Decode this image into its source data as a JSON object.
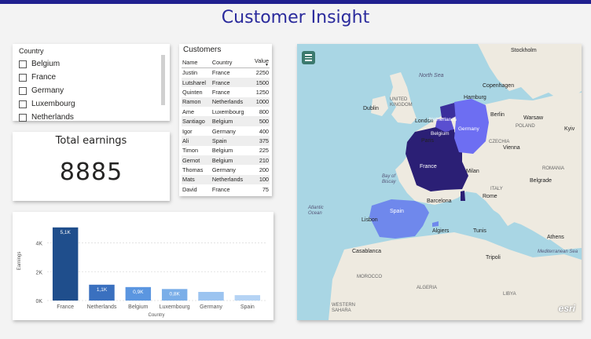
{
  "report": {
    "title": "Customer Insight"
  },
  "slicer": {
    "title": "Country",
    "items": [
      "Belgium",
      "France",
      "Germany",
      "Luxembourg",
      "Netherlands"
    ]
  },
  "kpi": {
    "label": "Total earnings",
    "value": "8885"
  },
  "customers": {
    "title": "Customers",
    "columns": [
      "Name",
      "Country",
      "Value"
    ],
    "rows": [
      [
        "Justin",
        "France",
        "2250"
      ],
      [
        "Lutsharel",
        "France",
        "1500"
      ],
      [
        "Quinten",
        "France",
        "1250"
      ],
      [
        "Ramon",
        "Netherlands",
        "1000"
      ],
      [
        "Ame",
        "Luxembourg",
        "800"
      ],
      [
        "Santiago",
        "Belgium",
        "500"
      ],
      [
        "Igor",
        "Germany",
        "400"
      ],
      [
        "Ali",
        "Spain",
        "375"
      ],
      [
        "Timon",
        "Belgium",
        "225"
      ],
      [
        "Gernot",
        "Belgium",
        "210"
      ],
      [
        "Thomas",
        "Germany",
        "200"
      ],
      [
        "Mats",
        "Netherlands",
        "100"
      ],
      [
        "David",
        "France",
        "75"
      ]
    ]
  },
  "chart_data": {
    "type": "bar",
    "categories": [
      "France",
      "Netherlands",
      "Belgium",
      "Luxembourg",
      "Germany",
      "Spain"
    ],
    "values": [
      5075,
      1100,
      935,
      800,
      600,
      375
    ],
    "data_labels": [
      "5,1K",
      "1,1K",
      "0,9K",
      "0,8K",
      "",
      ""
    ],
    "xlabel": "Country",
    "ylabel": "Earnings",
    "ylim": [
      0,
      5500
    ],
    "yticks": [
      0,
      2000,
      4000
    ],
    "ytick_labels": [
      "0K",
      "2K",
      "4K"
    ],
    "colors": [
      "#1f4e8c",
      "#3a70bf",
      "#5b96e0",
      "#7aaee8",
      "#9cc4f0",
      "#b5d3f4"
    ],
    "grid": true
  },
  "map": {
    "labels": {
      "stockholm": "Stockholm",
      "northsea": "North Sea",
      "copenhagen": "Copenhagen",
      "uk": "UNITED\nKINGDOM",
      "dublin": "Dublin",
      "hamburg": "Hamburg",
      "london": "London",
      "netherlands": "Netherlands",
      "berlin": "Berlin",
      "warsaw": "Warsaw",
      "poland": "POLAND",
      "kyiv": "Kyiv",
      "germany": "Germany",
      "belgium": "Belgium",
      "czechia": "CZECHIA",
      "paris": "Paris",
      "vienna": "Vienna",
      "france": "France",
      "milan": "Milan",
      "belgrade": "Belgrade",
      "romania": "ROMANIA",
      "italy": "ITALY",
      "rome": "Rome",
      "spain": "Spain",
      "barcelona": "Barcelona",
      "lisbon": "Lisbon",
      "athens": "Athens",
      "casablanca": "Casablanca",
      "algiers": "Algiers",
      "tunis": "Tunis",
      "tripoli": "Tripoli",
      "medsea": "Mediterranean Sea",
      "morocco": "MOROCCO",
      "algeria": "ALGERIA",
      "libya": "LIBYA",
      "westernsahara": "WESTERN\nSAHARA",
      "bay": "Bay of\nBiscay",
      "atlantic": "Atlantic\nOcean"
    },
    "attribution": "esri",
    "colors": {
      "france": "#2b1f75",
      "netherlands": "#3b2f9c",
      "belgium": "#5a4fd0",
      "germany": "#6d6ef2",
      "luxembourg": "#2b1f75",
      "spain": "#6f88ec",
      "sea": "#a9d6e4",
      "land": "#eeeae0"
    }
  }
}
